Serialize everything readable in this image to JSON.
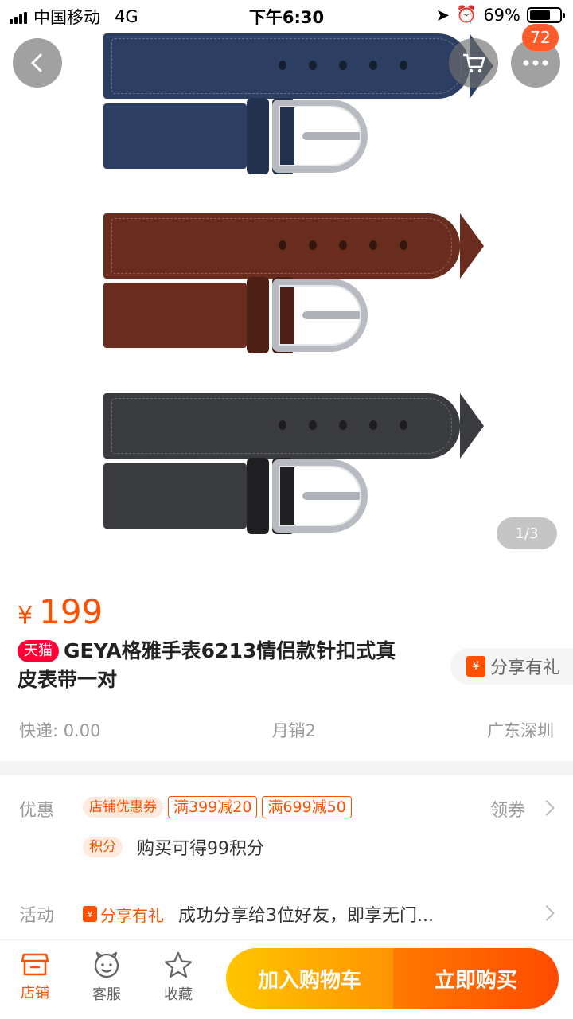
{
  "status_bar": {
    "carrier": "中国移动",
    "network": "4G",
    "time": "下午6:30",
    "battery": "69%",
    "battery_level": 0.69
  },
  "hero": {
    "cart_badge": "72",
    "pager": "1/3",
    "strap_colors": [
      "#2c3f62",
      "#6a2c1e",
      "#3a3b3e"
    ]
  },
  "product": {
    "currency": "¥",
    "price": "199",
    "tmall_badge": "天猫",
    "title": "GEYA格雅手表6213情侣款针扣式真皮表带一对",
    "share_gift": "分享有礼",
    "shipping": "快递: 0.00",
    "monthly_sales": "月销2",
    "location": "广东深圳"
  },
  "promotions": {
    "label": "优惠",
    "shop_coupon_tag": "店铺优惠券",
    "coupons": [
      "满399减20",
      "满699减50"
    ],
    "claim": "领券",
    "points_tag": "积分",
    "points_text": "购买可得99积分"
  },
  "activity": {
    "label": "活动",
    "tag": "分享有礼",
    "text": "成功分享给3位好友，即享无门..."
  },
  "bottom_bar": {
    "shop": "店铺",
    "service": "客服",
    "favorite": "收藏",
    "add_to_cart": "加入购物车",
    "buy_now": "立即购买"
  },
  "colors": {
    "accent": "#ff5000",
    "tmall": "#ff0036"
  }
}
